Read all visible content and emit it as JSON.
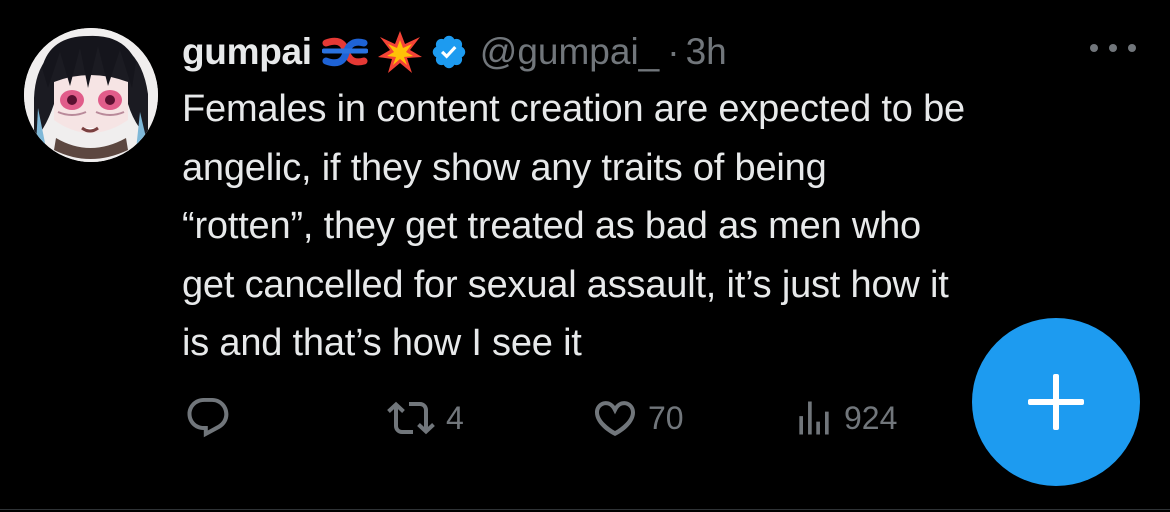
{
  "tweet": {
    "author_name": "gumpai",
    "author_emojis": [
      "knot-emoji",
      "collision-emoji"
    ],
    "verified": true,
    "handle": "@gumpai_",
    "separator": "·",
    "time": "3h",
    "text_lines": [
      "Females in content creation are expected to be",
      "angelic, if they show any traits of being",
      "“rotten”, they get treated as bad as men who",
      "get cancelled for sexual assault, it’s just how it",
      "is and that’s how I see it"
    ],
    "actions": {
      "reply_icon": "reply-icon",
      "retweet_icon": "retweet-icon",
      "retweet_count": "4",
      "like_icon": "heart-icon",
      "like_count": "70",
      "views_icon": "views-icon",
      "views_count": "924"
    }
  },
  "compose_button": {
    "icon": "plus-icon"
  },
  "colors": {
    "background": "#000000",
    "text": "#e7e9ea",
    "muted": "#71767b",
    "accent": "#1d9bf0"
  }
}
